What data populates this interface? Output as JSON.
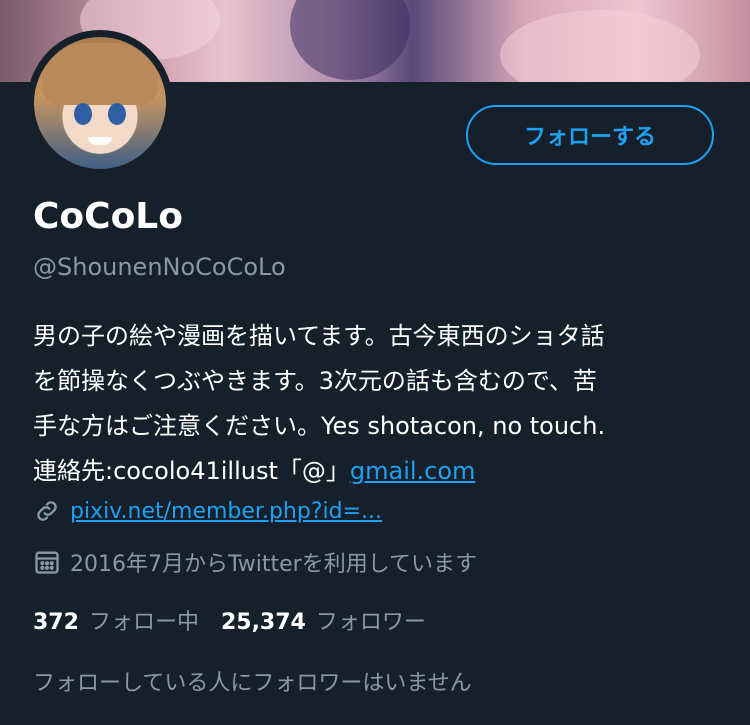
{
  "profile": {
    "display_name": "CoCoLo",
    "handle": "@ShounenNoCoCoLo",
    "follow_button_label": "フォローする",
    "bio": {
      "line1": "男の子の絵や漫画を描いてます。古今東西のショタ話",
      "line2": "を節操なくつぶやきます。3次元の話も含むので、苦",
      "line3": "手な方はご注意ください。Yes shotacon, no touch.",
      "line4_prefix": "連絡先:cocolo41illust「@」",
      "line4_link": "gmail.com"
    },
    "website": "pixiv.net/member.php?id=...",
    "joined": "2016年7月からTwitterを利用しています",
    "following_count": "372",
    "following_label": "フォロー中",
    "followers_count": "25,374",
    "followers_label": "フォロワー",
    "followed_by_note": "フォローしている人にフォロワーはいません"
  },
  "icons": {
    "link": "link-icon",
    "calendar": "calendar-icon"
  },
  "colors": {
    "background": "#15202b",
    "accent": "#1da1f2",
    "secondary_text": "#8899a6",
    "primary_text": "#ffffff"
  }
}
